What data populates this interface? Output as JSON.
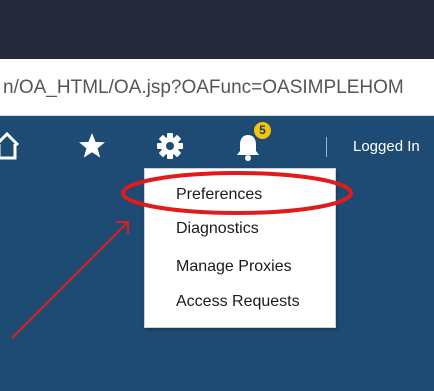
{
  "browser": {
    "url": "n/OA_HTML/OA.jsp?OAFunc=OASIMPLEHOM"
  },
  "toolbar": {
    "notification_count": "5",
    "logged_in_label": "Logged In"
  },
  "menu": {
    "items": [
      {
        "label": "Preferences"
      },
      {
        "label": "Diagnostics"
      },
      {
        "label": "Manage Proxies"
      },
      {
        "label": "Access Requests"
      }
    ]
  },
  "icons": {
    "home": "home-icon",
    "favorites": "star-icon",
    "settings": "gear-icon",
    "notifications": "bell-icon"
  },
  "colors": {
    "app_bar": "#1e4b73",
    "browser_chrome": "#242a3a",
    "badge": "#f4c30f",
    "annotation": "#e01b1b"
  }
}
